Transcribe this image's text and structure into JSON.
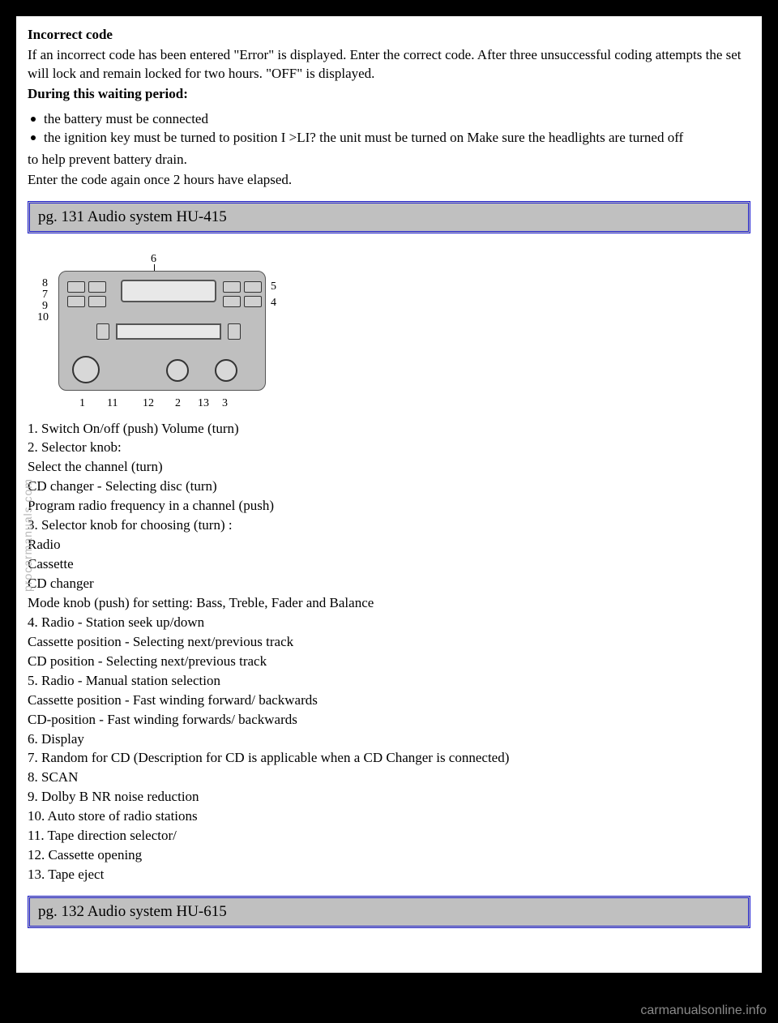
{
  "intro": {
    "heading": "Incorrect code",
    "p1": "If an incorrect code has been entered \"Error\" is displayed. Enter the correct code. After three unsuccessful coding attempts the set will lock and remain locked for two hours. \"OFF\" is displayed.",
    "p2": "During this waiting period:",
    "bullets": [
      "the battery must be connected",
      "the ignition key must be turned to position I >LI? the unit must be turned on Make sure the headlights are turned off"
    ],
    "p3": "to help prevent battery drain.",
    "p4": "Enter the code again once 2 hours have elapsed."
  },
  "section1": {
    "title": "pg. 131 Audio system HU-415"
  },
  "callouts": {
    "c1": "1",
    "c2": "2",
    "c3": "3",
    "c4": "4",
    "c5": "5",
    "c6": "6",
    "c7": "7",
    "c8": "8",
    "c9": "9",
    "c10": "10",
    "c11": "11",
    "c12": "12",
    "c13": "13"
  },
  "items": [
    "1. Switch On/off (push) Volume (turn)",
    "2. Selector knob:",
    "Select the channel (turn)",
    "CD changer - Selecting disc (turn)",
    "Program radio frequency in a channel (push)",
    "3. Selector knob for choosing (turn) :",
    "Radio",
    "Cassette",
    "CD changer",
    "Mode knob (push) for setting: Bass, Treble, Fader and Balance",
    "4. Radio - Station seek up/down",
    "Cassette position - Selecting next/previous track",
    "CD position - Selecting next/previous track",
    "5. Radio - Manual station selection",
    "Cassette position - Fast winding forward/ backwards",
    "CD-position - Fast winding forwards/ backwards",
    "6. Display",
    "7. Random for CD (Description for CD is applicable when a CD Changer is connected)",
    "8. SCAN",
    "9. Dolby B NR noise reduction",
    "10. Auto store of radio stations",
    "11. Tape direction selector/",
    "12. Cassette opening",
    "13. Tape eject"
  ],
  "section2": {
    "title": "pg. 132 Audio system HU-615"
  },
  "watermark_side": "procarmanuals.com",
  "watermark_footer": "carmanualsonline.info"
}
